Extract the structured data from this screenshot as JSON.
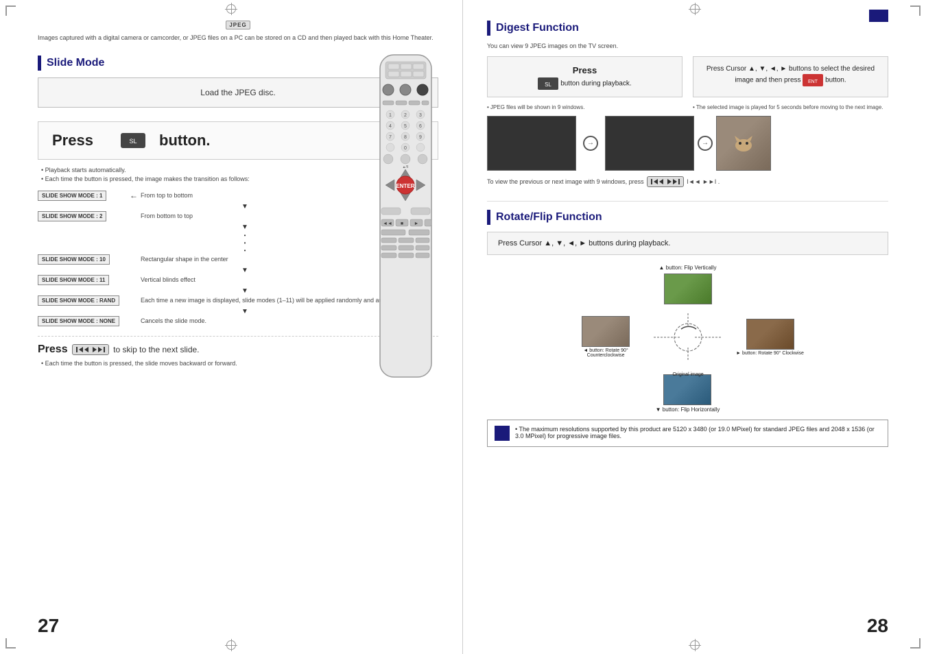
{
  "pages": {
    "left": {
      "number": "27",
      "badge": "JPEG",
      "intro": "Images captured with a digital camera or camcorder, or JPEG files on a PC can be stored on a CD and then played back with this Home Theater.",
      "section_title": "Slide Mode",
      "load_disc": "Load the JPEG disc.",
      "press_label": "Press",
      "press_button_label": "button.",
      "bullet1": "Playback starts automatically.",
      "bullet2": "Each time the button is pressed, the image makes the transition as follows:",
      "slide_modes": [
        {
          "badge": "SLIDE SHOW MODE : 1",
          "desc": "From top to bottom"
        },
        {
          "badge": "SLIDE SHOW MODE : 2",
          "desc": "From bottom to top"
        },
        {
          "badge": "SLIDE SHOW MODE : 10",
          "desc": "Rectangular shape in the center"
        },
        {
          "badge": "SLIDE SHOW MODE : 11",
          "desc": "Vertical blinds effect"
        },
        {
          "badge": "SLIDE SHOW MODE : RAND",
          "desc": "Each time a new image is displayed, slide modes (1–11) will be applied randomly and automatically."
        },
        {
          "badge": "SLIDE SHOW MODE : NONE",
          "desc": "Cancels the slide mode."
        }
      ],
      "skip_press": "Press",
      "skip_buttons": "I◄◄ ►►I",
      "skip_text": "to skip to the next slide.",
      "skip_bullet": "Each time the button is pressed, the slide moves backward or forward."
    },
    "right": {
      "number": "28",
      "digest_title": "Digest Function",
      "digest_subtitle": "You can view 9 JPEG images on the TV screen.",
      "step1_press": "Press",
      "step1_text": "button during playback.",
      "step2_text": "Press Cursor ▲, ▼, ◄, ► buttons to select the desired image and then press",
      "step2_button": "button.",
      "digest_bullet1": "JPEG files will be shown in 9 windows.",
      "digest_bullet2": "The selected image is played for 5 seconds before moving to the next image.",
      "to_note": "To view the previous or next image with 9 windows, press",
      "to_note2": "I◄◄ ►►I .",
      "rotate_title": "Rotate/Flip Function",
      "rotate_press": "Press Cursor ▲, ▼, ◄, ► buttons during playback.",
      "rotate_up": "▲ button: Flip Vertically",
      "rotate_left": "◄ button: Rotate 90° Counterclockwise",
      "rotate_right": "► button: Rotate 90° Clockwise",
      "rotate_down": "▼ button: Flip Horizontally",
      "rotate_original": "Original image",
      "bottom_note": "• The maximum resolutions supported by this product are 5120 x 3480 (or 19.0 MPixel) for standard JPEG files and 2048 x 1536 (or 3.0 MPixel) for progressive image files."
    }
  }
}
